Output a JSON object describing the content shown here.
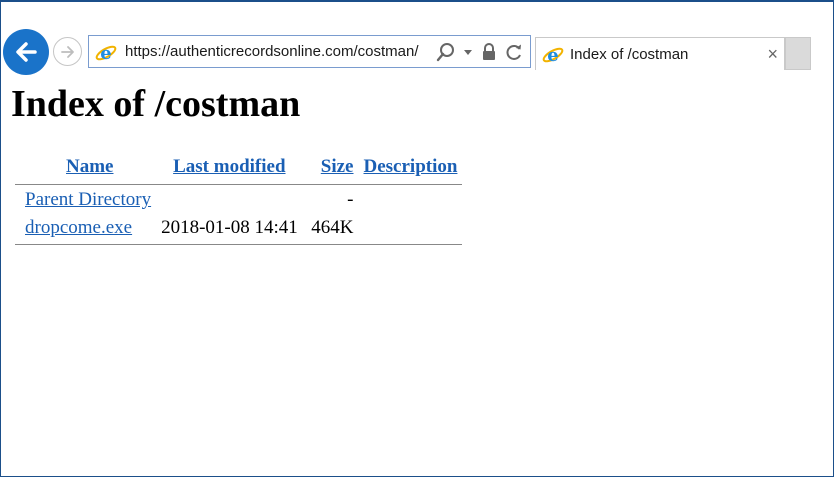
{
  "browser": {
    "url": "https://authenticrecordsonline.com/costman/",
    "tab_title": "Index of /costman",
    "tab_close": "×",
    "icons": {
      "back": "back-arrow-icon",
      "forward": "forward-arrow-icon",
      "site": "internet-explorer-icon",
      "search": "search-icon",
      "dropdown": "chevron-down-icon",
      "lock": "lock-icon",
      "refresh": "refresh-icon"
    },
    "colors": {
      "back_button": "#1a73c9",
      "link": "#1a5fb4"
    }
  },
  "page": {
    "title": "Index of /costman",
    "columns": {
      "name": "Name",
      "last_modified": "Last modified",
      "size": "Size",
      "description": "Description"
    },
    "rows": [
      {
        "name": "Parent Directory",
        "last_modified": "",
        "size": "-",
        "description": ""
      },
      {
        "name": "dropcome.exe",
        "last_modified": "2018-01-08 14:41",
        "size": "464K",
        "description": ""
      }
    ]
  }
}
